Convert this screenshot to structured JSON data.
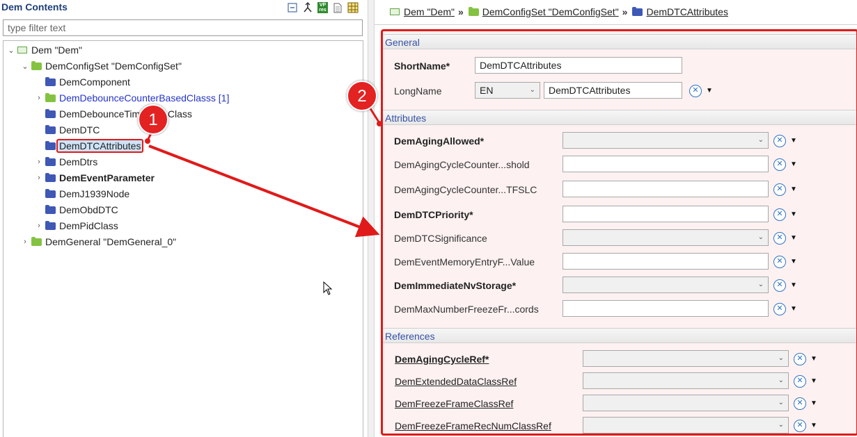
{
  "left": {
    "title": "Dem Contents",
    "toolbar": {
      "icons": [
        "collapse-all-icon",
        "link-icon",
        "vp-res-icon",
        "document-icon",
        "grid-icon"
      ],
      "vp_text": "VP",
      "res_text": "res"
    },
    "filter_placeholder": "type filter text",
    "tree": [
      {
        "label": "Dem \"Dem\"",
        "icon": "module-icon",
        "expanded": true
      },
      {
        "label": "DemConfigSet \"DemConfigSet\"",
        "icon": "green-folder-icon",
        "expanded": true
      },
      {
        "label": "DemComponent",
        "icon": "blue-folder-icon"
      },
      {
        "label": "DemDebounceCounterBasedClasss [1]",
        "icon": "green-folder-icon",
        "collapsed": true,
        "style": "link"
      },
      {
        "label": "DemDebounceTimeBaseClass",
        "icon": "blue-folder-icon"
      },
      {
        "label": "DemDTC",
        "icon": "blue-folder-icon"
      },
      {
        "label": "DemDTCAttributes",
        "icon": "blue-folder-icon",
        "selected": true
      },
      {
        "label": "DemDtrs",
        "icon": "blue-folder-icon",
        "collapsed": true
      },
      {
        "label": "DemEventParameter",
        "icon": "blue-folder-icon",
        "collapsed": true,
        "style": "bold"
      },
      {
        "label": "DemJ1939Node",
        "icon": "blue-folder-icon"
      },
      {
        "label": "DemObdDTC",
        "icon": "blue-folder-icon"
      },
      {
        "label": "DemPidClass",
        "icon": "blue-folder-icon",
        "collapsed": true
      },
      {
        "label": "DemGeneral \"DemGeneral_0\"",
        "icon": "green-folder-icon",
        "collapsed": true
      }
    ]
  },
  "breadcrumb": [
    {
      "label": "Dem \"Dem\"",
      "icon": "module-icon"
    },
    {
      "label": "DemConfigSet \"DemConfigSet\"",
      "icon": "green-folder-icon"
    },
    {
      "label": "DemDTCAttributes",
      "icon": "blue-folder-icon"
    }
  ],
  "breadcrumb_separator": "»",
  "form": {
    "general": {
      "title": "General",
      "shortname_label": "ShortName*",
      "shortname_value": "DemDTCAttributes",
      "longname_label": "LongName",
      "longname_lang": "EN",
      "longname_value": "DemDTCAttributes"
    },
    "attributes": {
      "title": "Attributes",
      "fields": [
        {
          "label": "DemAgingAllowed*",
          "bold": true,
          "type": "combo",
          "value": ""
        },
        {
          "label": "DemAgingCycleCounter...shold",
          "bold": false,
          "type": "text",
          "value": ""
        },
        {
          "label": "DemAgingCycleCounter...TFSLC",
          "bold": false,
          "type": "text",
          "value": ""
        },
        {
          "label": "DemDTCPriority*",
          "bold": true,
          "type": "text",
          "value": ""
        },
        {
          "label": "DemDTCSignificance",
          "bold": false,
          "type": "combo",
          "value": ""
        },
        {
          "label": "DemEventMemoryEntryF...Value",
          "bold": false,
          "type": "text",
          "value": ""
        },
        {
          "label": "DemImmediateNvStorage*",
          "bold": true,
          "type": "combo",
          "value": ""
        },
        {
          "label": "DemMaxNumberFreezeFr...cords",
          "bold": false,
          "type": "text",
          "value": ""
        }
      ]
    },
    "references": {
      "title": "References",
      "fields": [
        {
          "label": "DemAgingCycleRef*",
          "bold": true,
          "value": ""
        },
        {
          "label": "DemExtendedDataClassRef",
          "bold": false,
          "value": ""
        },
        {
          "label": "DemFreezeFrameClassRef",
          "bold": false,
          "value": ""
        },
        {
          "label": "DemFreezeFrameRecNumClassRef",
          "bold": false,
          "value": ""
        }
      ]
    },
    "action_glyph": "✕",
    "menu_glyph": "▼",
    "combo_glyph": "⌄"
  },
  "annotations": {
    "callout_1": "1",
    "callout_2": "2",
    "color": "#e01a1a"
  },
  "colors": {
    "accent": "#e01a1a",
    "section_text": "#3552a6",
    "link": "#2433c9",
    "selection": "#cde3f7"
  }
}
